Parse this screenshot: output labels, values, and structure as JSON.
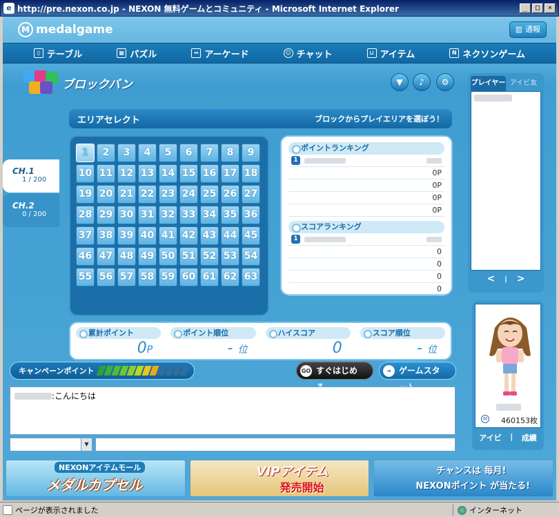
{
  "window": {
    "title": "http://pre.nexon.co.jp - NEXON 無料ゲームとコミュニティ - Microsoft Internet Explorer",
    "minimize": "_",
    "maximize": "□",
    "close": "×"
  },
  "header": {
    "logo": "medalgame",
    "notice_label": "通報"
  },
  "nav": [
    {
      "label": "テーブル",
      "icon": "table-icon"
    },
    {
      "label": "パズル",
      "icon": "puzzle-icon"
    },
    {
      "label": "アーケード",
      "icon": "arcade-icon"
    },
    {
      "label": "チャット",
      "icon": "chat-icon"
    },
    {
      "label": "アイテム",
      "icon": "cart-icon"
    },
    {
      "label": "ネクソンゲーム",
      "icon": "nexon-icon"
    }
  ],
  "game": {
    "title": "ブロックバン"
  },
  "area": {
    "title": "エリアセレクト",
    "subtitle": "ブロックからプレイエリアを選ぼう！",
    "blocks": 63,
    "selected": 1
  },
  "channels": [
    {
      "name": "CH.1",
      "count": "1 / 200"
    },
    {
      "name": "CH.2",
      "count": "0 / 200"
    }
  ],
  "point_ranking": {
    "title": "ポイントランキング",
    "rows": [
      "",
      "0P",
      "0P",
      "0P",
      "0P"
    ]
  },
  "score_ranking": {
    "title": "スコアランキング",
    "rows": [
      "",
      "0",
      "0",
      "0",
      "0"
    ]
  },
  "stats": [
    {
      "label": "累計ポイント",
      "value": "0",
      "unit": "P"
    },
    {
      "label": "ポイント順位",
      "value": "-",
      "unit": "位"
    },
    {
      "label": "ハイスコア",
      "value": "0",
      "unit": ""
    },
    {
      "label": "スコア順位",
      "value": "-",
      "unit": "位"
    }
  ],
  "campaign": {
    "label": "キャンペーンポイント",
    "level": 8,
    "max": 12
  },
  "buttons": {
    "quick": "すぐはじめる",
    "quick_icon": "GO",
    "start": "ゲームスタート"
  },
  "chat": {
    "message": ":こんにちは"
  },
  "player_panel": {
    "tab_player": "プレイヤー",
    "tab_friend": "アイビ友",
    "prev": "<",
    "next": ">"
  },
  "avatar": {
    "coins": "460153枚",
    "link_avibi": "アイビ",
    "link_results": "成績"
  },
  "banners": {
    "b1_top": "NEXONアイテムモール",
    "b1_main": "メダルカプセル",
    "b2_main": "VIPアイテム",
    "b2_sub": "発売開始",
    "b3_top": "チャンスは 毎月!",
    "b3_main": "NEXONポイント が当たる!"
  },
  "statusbar": {
    "text": "ページが表示されました",
    "zone": "インターネット"
  },
  "colors": {
    "accent": "#1b7db9",
    "panel_bg": "#4fa8d8",
    "cell": "#5eb3e4"
  }
}
